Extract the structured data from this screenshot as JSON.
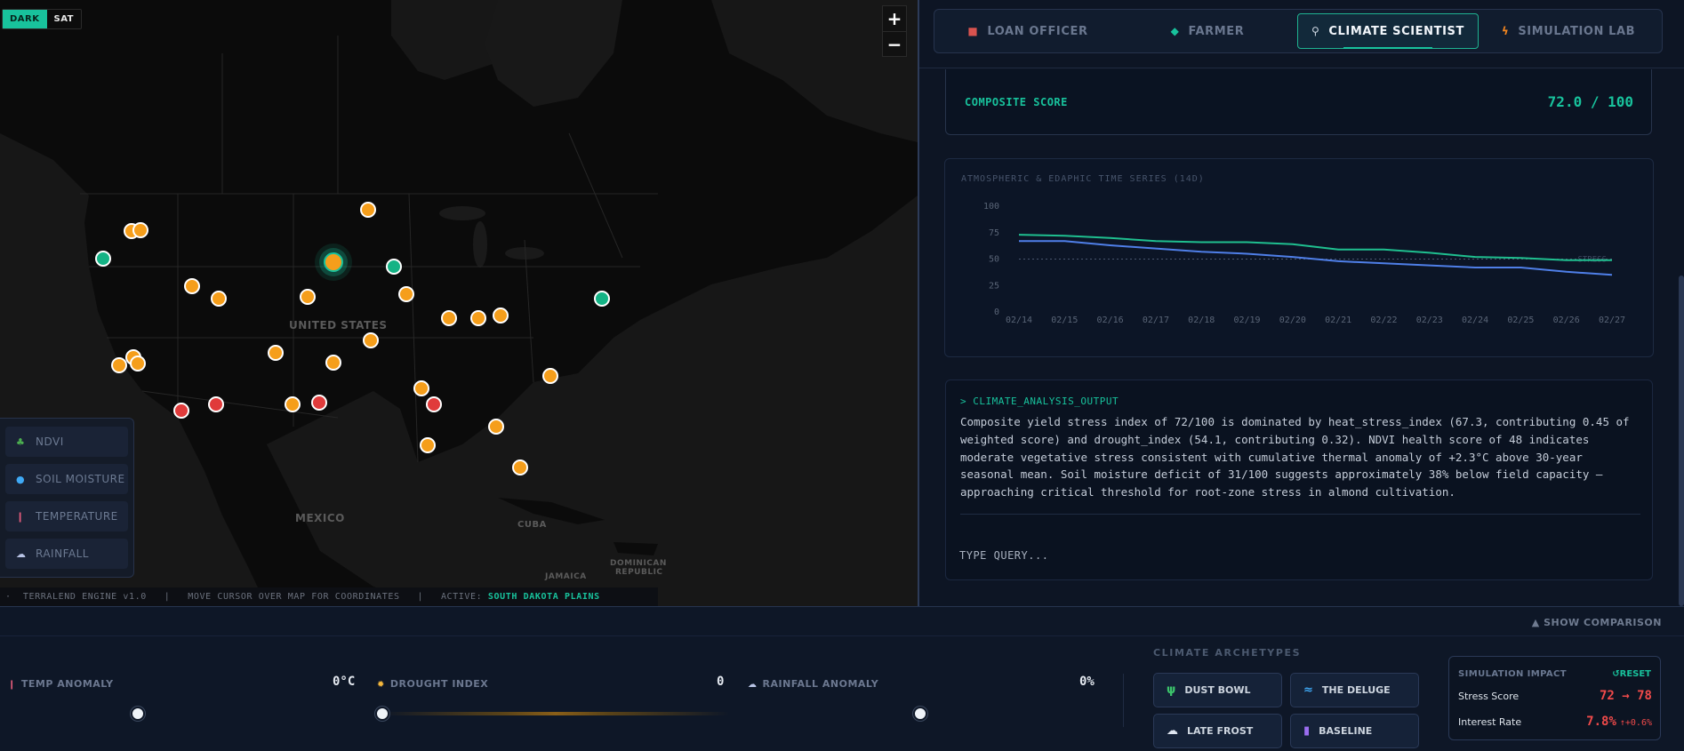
{
  "map": {
    "style_toggle": {
      "dark": "DARK",
      "sat": "SAT",
      "active": "dark"
    },
    "zoom": {
      "in": "+",
      "out": "−"
    },
    "labels": {
      "us": "UNITED STATES",
      "mexico": "MEXICO",
      "cuba": "CUBA",
      "jamaica": "JAMAICA",
      "dominican_top": "DOMINICAN",
      "dominican_bottom": "REPUBLIC"
    },
    "pin_colors": {
      "orange": "#f59e1b",
      "green": "#14b385",
      "red": "#e03b3b"
    },
    "layers": [
      {
        "label": "NDVI",
        "icon": "sprout-icon"
      },
      {
        "label": "SOIL MOISTURE",
        "icon": "droplet-icon"
      },
      {
        "label": "TEMPERATURE",
        "icon": "thermometer-icon"
      },
      {
        "label": "RAINFALL",
        "icon": "rain-cloud-icon"
      }
    ],
    "status": {
      "engine": "TERRALEND ENGINE v1.0",
      "hint": "MOVE CURSOR OVER MAP FOR COORDINATES",
      "active_label": "ACTIVE:",
      "active_value": "SOUTH DAKOTA PLAINS"
    }
  },
  "tabs": [
    {
      "label": "LOAN OFFICER",
      "icon": "briefcase-icon",
      "active": false
    },
    {
      "label": "FARMER",
      "icon": "tractor-icon",
      "active": false
    },
    {
      "label": "CLIMATE SCIENTIST",
      "icon": "microscope-icon",
      "active": true
    },
    {
      "label": "SIMULATION LAB",
      "icon": "lightning-icon",
      "active": false
    }
  ],
  "composite": {
    "label": "COMPOSITE SCORE",
    "value": "72.0 / 100"
  },
  "chart_data": {
    "type": "line",
    "title": "ATMOSPHERIC & EDAPHIC TIME SERIES (14D)",
    "categories": [
      "02/14",
      "02/15",
      "02/16",
      "02/17",
      "02/18",
      "02/19",
      "02/20",
      "02/21",
      "02/22",
      "02/23",
      "02/24",
      "02/25",
      "02/26",
      "02/27"
    ],
    "ylim": [
      0,
      100
    ],
    "yticks": [
      0,
      25,
      50,
      75,
      100
    ],
    "series": [
      {
        "color": "#1fbf8f",
        "values": [
          73,
          72,
          70,
          67,
          66,
          66,
          64,
          59,
          59,
          56,
          52,
          51,
          49,
          49
        ]
      },
      {
        "color": "#4f7fe8",
        "values": [
          67,
          67,
          63,
          60,
          57,
          55,
          52,
          48,
          46,
          44,
          42,
          42,
          38,
          35
        ]
      }
    ],
    "reference": {
      "value": 50,
      "label": "STRESS"
    },
    "grid": false
  },
  "console": {
    "title": "> CLIMATE_ANALYSIS_OUTPUT",
    "text": "Composite yield stress index of 72/100 is dominated by heat_stress_index (67.3, contributing 0.45 of weighted score) and drought_index (54.1, contributing 0.32). NDVI health score of 48 indicates moderate vegetative stress consistent with cumulative thermal anomaly of +2.3°C above 30-year seasonal mean. Soil moisture deficit of 31/100 suggests approximately 38% below field capacity — approaching critical threshold for root-zone stress in almond cultivation.",
    "query_placeholder": "TYPE QUERY..."
  },
  "bottom": {
    "show_comparison": "▲ SHOW COMPARISON",
    "sliders": [
      {
        "label": "TEMP ANOMALY",
        "icon": "thermometer-icon",
        "value_text": "0°C",
        "fraction": 0.5
      },
      {
        "label": "DROUGHT INDEX",
        "icon": "sun-icon",
        "value_text": "0",
        "fraction": 0.0
      },
      {
        "label": "RAINFALL ANOMALY",
        "icon": "rain-cloud-icon",
        "value_text": "0%",
        "fraction": 0.5
      }
    ],
    "archetypes_title": "CLIMATE ARCHETYPES",
    "archetypes": [
      {
        "label": "DUST BOWL",
        "icon": "cactus-icon"
      },
      {
        "label": "THE DELUGE",
        "icon": "wave-icon"
      },
      {
        "label": "LATE FROST",
        "icon": "snow-cloud-icon"
      },
      {
        "label": "BASELINE",
        "icon": "bar-chart-icon"
      }
    ],
    "impact": {
      "title": "SIMULATION IMPACT",
      "reset": "↺RESET",
      "stress_label": "Stress Score",
      "stress_value": "72 → 78",
      "rate_label": "Interest Rate",
      "rate_value": "7.8%",
      "rate_delta": "↑+0.6%"
    },
    "accent": "#18c29c"
  }
}
